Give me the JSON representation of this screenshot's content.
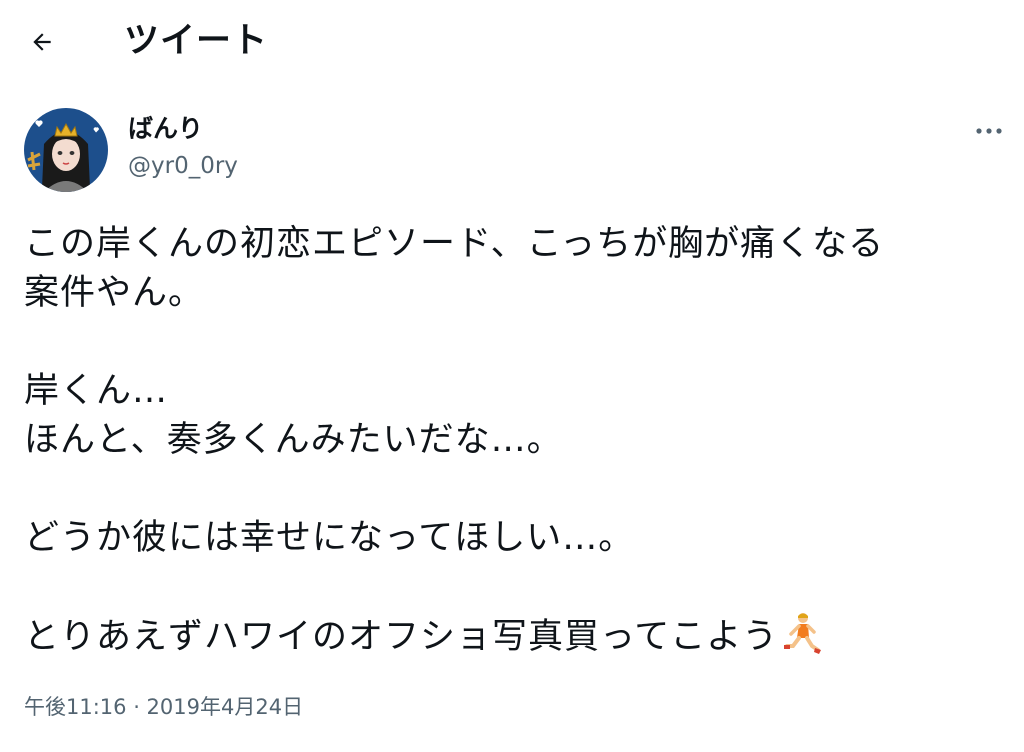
{
  "header": {
    "title": "ツイート",
    "back_icon": "arrow-left-icon"
  },
  "author": {
    "display_name": "ばんり",
    "handle": "@yr0_0ry",
    "avatar_icon": "avatar-illustration"
  },
  "more_icon": "more-horizontal-icon",
  "tweet": {
    "lines": [
      "この岸くんの初恋エピソード、こっちが胸が痛くなる",
      "案件やん。",
      "",
      "岸くん…",
      "ほんと、奏多くんみたいだな…。",
      "",
      "どうか彼には幸せになってほしい…。",
      "",
      "とりあえずハワイのオフショ写真買ってこよう"
    ],
    "trailing_emoji": "running-person-emoji"
  },
  "timestamp": "午後11:16 · 2019年4月24日"
}
